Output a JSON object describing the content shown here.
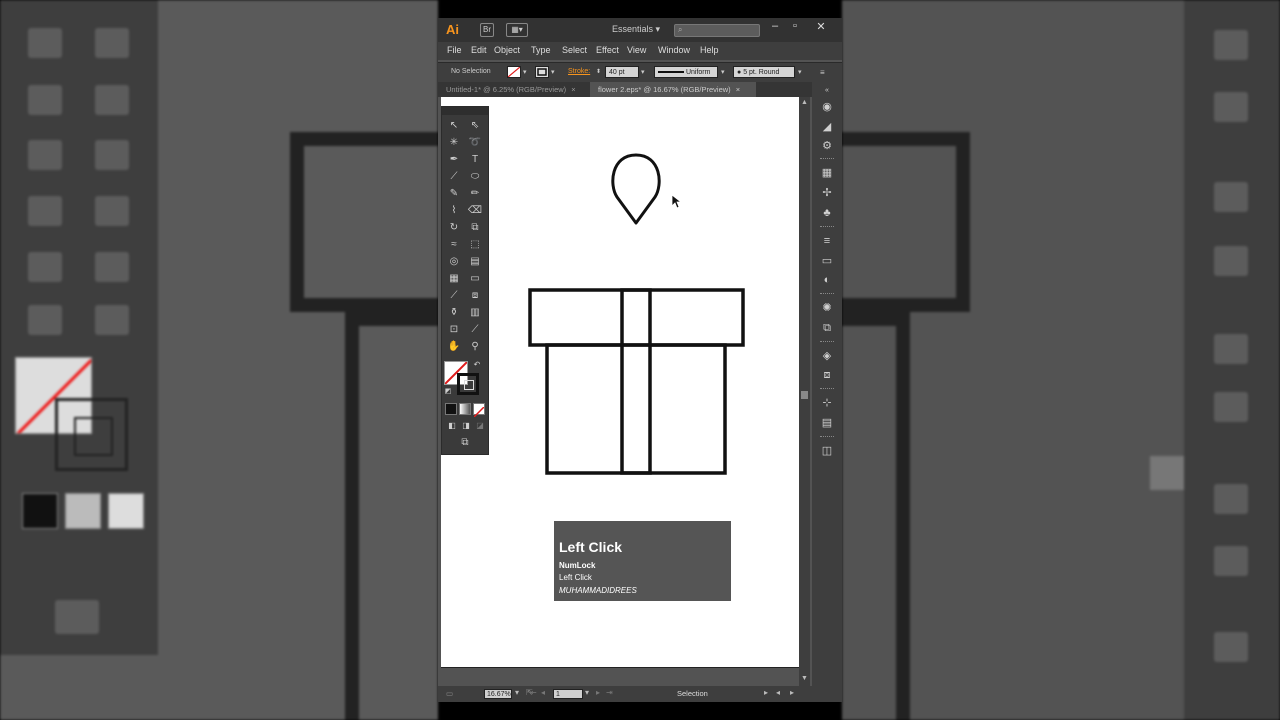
{
  "app": {
    "logo": "Ai",
    "bridge_label": "Br",
    "workspace": "Essentials",
    "search_placeholder": ""
  },
  "menu": [
    "File",
    "Edit",
    "Object",
    "Type",
    "Select",
    "Effect",
    "View",
    "Window",
    "Help"
  ],
  "control_bar": {
    "selection": "No Selection",
    "stroke_label": "Stroke:",
    "stroke_weight": "40 pt",
    "profile": "Uniform",
    "brush": "5 pt. Round"
  },
  "tabs": [
    {
      "label": "Untitled-1* @ 6.25% (RGB/Preview)",
      "active": false
    },
    {
      "label": "flower 2.eps* @ 16.67% (RGB/Preview)",
      "active": true
    }
  ],
  "status_bar": {
    "zoom": "16.67%",
    "page": "1",
    "tool": "Selection"
  },
  "overlay": {
    "title": "Left Click",
    "key": "NumLock",
    "action": "Left Click",
    "credit": "MUHAMMADIDREES"
  },
  "colors": {
    "app_bg": "#535353",
    "panel": "#3e3e3e",
    "logo": "#f7941d",
    "none_slash": "#e01b1b",
    "artboard": "#ffffff"
  },
  "icons": {
    "fill": "none-fill-swatch",
    "stroke": "black-stroke-swatch"
  }
}
